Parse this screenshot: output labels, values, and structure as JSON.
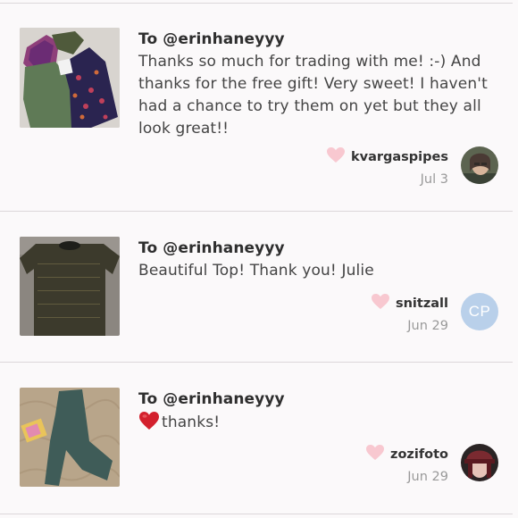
{
  "notes": [
    {
      "to": "To @erinhaneyyy",
      "message": "Thanks so much for trading with me! :-) And thanks for the free gift! Very sweet! I haven't had a chance to try them on yet but they all look great!!",
      "username": "kvargaspipes",
      "date": "Jul 3",
      "avatar": "photo"
    },
    {
      "to": "To @erinhaneyyy",
      "message": "Beautiful Top! Thank you! Julie",
      "username": "snitzall",
      "date": "Jun 29",
      "avatar_initials": "CP"
    },
    {
      "to": "To @erinhaneyyy",
      "message": "thanks!",
      "message_icon": "red-heart-emoji-icon",
      "username": "zozifoto",
      "date": "Jun 29",
      "avatar": "photo"
    }
  ],
  "colors": {
    "background": "#fbf9fa",
    "heart": "#f8c8d0",
    "initials_avatar": "#b9d0ea",
    "date": "#999999"
  }
}
